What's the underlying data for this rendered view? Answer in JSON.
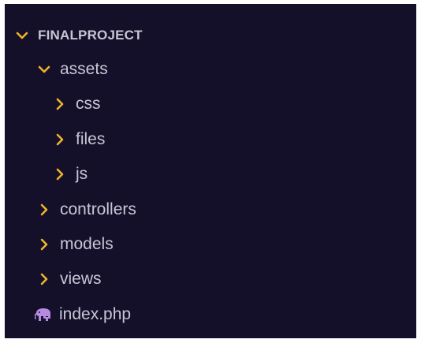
{
  "explorer": {
    "root": {
      "label": "FINALPROJECT",
      "icon": "chevron-down-icon",
      "expanded": true
    },
    "items": [
      {
        "label": "assets",
        "icon": "chevron-down-icon",
        "expanded": true
      },
      {
        "label": "css",
        "icon": "chevron-right-icon",
        "expanded": false
      },
      {
        "label": "files",
        "icon": "chevron-right-icon",
        "expanded": false
      },
      {
        "label": "js",
        "icon": "chevron-right-icon",
        "expanded": false
      },
      {
        "label": "controllers",
        "icon": "chevron-right-icon",
        "expanded": false
      },
      {
        "label": "models",
        "icon": "chevron-right-icon",
        "expanded": false
      },
      {
        "label": "views",
        "icon": "chevron-right-icon",
        "expanded": false
      },
      {
        "label": "index.php",
        "icon": "php-elephant-icon"
      }
    ]
  },
  "colors": {
    "background": "#14102a",
    "text": "#c8c6d6",
    "chevron": "#f0b429",
    "php_icon": "#b58ae0"
  }
}
